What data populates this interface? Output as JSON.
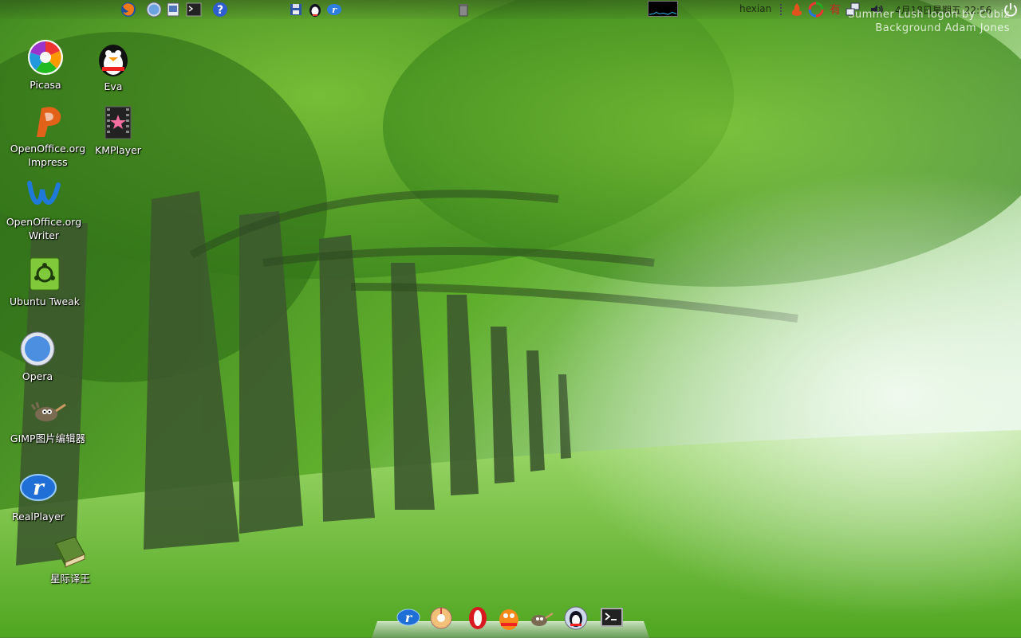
{
  "wallpaper": {
    "credit_line1": "Summer Lush logon by Cubiz",
    "credit_line2": "Background  Adam Jones"
  },
  "top_panel": {
    "launchers": [
      "firefox-icon",
      "safari-compass-icon",
      "file-browser-icon",
      "terminal-icon",
      "help-icon"
    ],
    "tray_launchers": [
      "save-disk-icon",
      "penguin-icon",
      "realplayer-icon"
    ],
    "trash": "trash-icon",
    "user": "hexian",
    "clock": "4月18日星期五  22:56",
    "tray_icons": [
      "grip-icon",
      "fire-icon",
      "color-wheel-icon",
      "input-method-icon",
      "network-icon",
      "volume-icon"
    ],
    "power": "power-icon"
  },
  "desktop_icons": [
    {
      "name": "Picasa"
    },
    {
      "name": "Eva"
    },
    {
      "name": "OpenOffice.org Impress"
    },
    {
      "name": "KMPlayer"
    },
    {
      "name": "OpenOffice.org Writer"
    },
    {
      "name": "Ubuntu Tweak"
    },
    {
      "name": "Opera"
    },
    {
      "name": "GIMP图片编辑器"
    },
    {
      "name": "RealPlayer"
    },
    {
      "name": "星际译王"
    }
  ],
  "dock": {
    "items": [
      "realplayer-icon",
      "media-player-icon",
      "opera-icon",
      "qq-icon",
      "gimp-icon",
      "penguin-icon",
      "terminal-icon"
    ]
  },
  "colors": {
    "accent_green": "#5fae2c",
    "panel_text": "#1e2a10"
  }
}
